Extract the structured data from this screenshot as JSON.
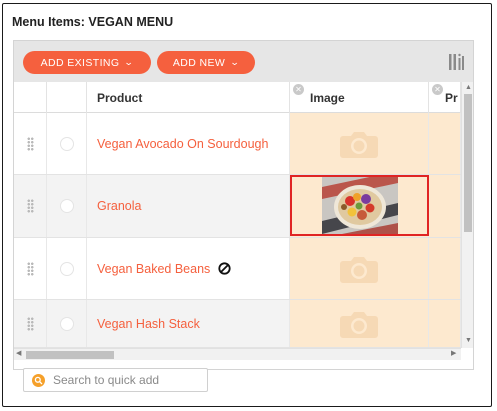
{
  "panel": {
    "title": "Menu Items: VEGAN MENU"
  },
  "toolbar": {
    "add_existing_label": "ADD EXISTING",
    "add_new_label": "ADD NEW",
    "chevron": "⌄",
    "columns_icon": "column-toggle-icon"
  },
  "columns": {
    "product": "Product",
    "image": "Image",
    "price_truncated": "Pr"
  },
  "rows": [
    {
      "product": "Vegan Avocado On Sourdough",
      "has_image": false,
      "unavailable": false
    },
    {
      "product": "Granola",
      "has_image": true,
      "unavailable": false,
      "selected_image": true
    },
    {
      "product": "Vegan Baked Beans",
      "has_image": false,
      "unavailable": true
    },
    {
      "product": "Vegan Hash Stack",
      "has_image": false,
      "unavailable": false
    }
  ],
  "search": {
    "placeholder": "Search to quick add"
  },
  "colors": {
    "accent": "#f5603e",
    "image_cell_bg": "#fde9cf",
    "selection_border": "#e02424",
    "search_icon": "#f5a02a"
  }
}
